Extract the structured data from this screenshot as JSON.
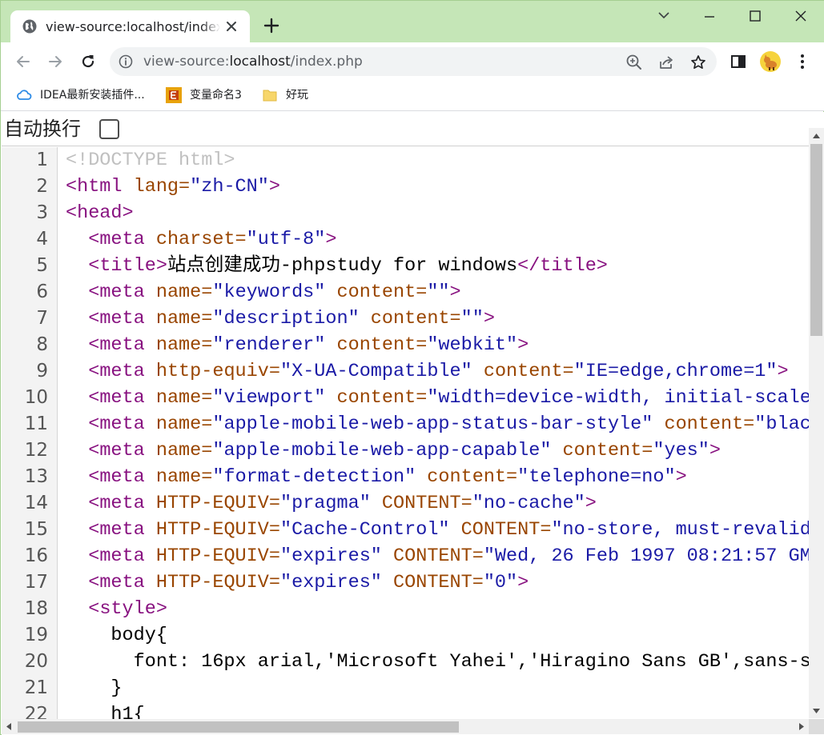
{
  "browser": {
    "tab": {
      "title": "view-source:localhost/index.php"
    },
    "url": {
      "scheme": "view-source:",
      "host": "localhost",
      "path": "/index.php"
    },
    "bookmarks": [
      {
        "label": "IDEA最新安装插件..."
      },
      {
        "label": "变量命名3"
      },
      {
        "label": "好玩"
      }
    ]
  },
  "viewer": {
    "wrap_label": "自动换行",
    "wrap_checked": false
  },
  "source_lines": [
    {
      "n": "1",
      "parts": [
        [
          "doc",
          "<!DOCTYPE html>"
        ]
      ]
    },
    {
      "n": "2",
      "parts": [
        [
          "tag",
          "<html "
        ],
        [
          "attr",
          "lang="
        ],
        [
          "val",
          "\"zh-CN\""
        ],
        [
          "tag",
          ">"
        ]
      ]
    },
    {
      "n": "3",
      "parts": [
        [
          "tag",
          "<head>"
        ]
      ]
    },
    {
      "n": "4",
      "parts": [
        [
          "txt",
          "  "
        ],
        [
          "tag",
          "<meta "
        ],
        [
          "attr",
          "charset="
        ],
        [
          "val",
          "\"utf-8\""
        ],
        [
          "tag",
          ">"
        ]
      ]
    },
    {
      "n": "5",
      "parts": [
        [
          "txt",
          "  "
        ],
        [
          "tag",
          "<title>"
        ],
        [
          "txt",
          "站点创建成功-phpstudy for windows"
        ],
        [
          "tag",
          "</title>"
        ]
      ]
    },
    {
      "n": "6",
      "parts": [
        [
          "txt",
          "  "
        ],
        [
          "tag",
          "<meta "
        ],
        [
          "attr",
          "name="
        ],
        [
          "val",
          "\"keywords\""
        ],
        [
          "attr",
          " content="
        ],
        [
          "val",
          "\"\""
        ],
        [
          "tag",
          ">"
        ]
      ]
    },
    {
      "n": "7",
      "parts": [
        [
          "txt",
          "  "
        ],
        [
          "tag",
          "<meta "
        ],
        [
          "attr",
          "name="
        ],
        [
          "val",
          "\"description\""
        ],
        [
          "attr",
          " content="
        ],
        [
          "val",
          "\"\""
        ],
        [
          "tag",
          ">"
        ]
      ]
    },
    {
      "n": "8",
      "parts": [
        [
          "txt",
          "  "
        ],
        [
          "tag",
          "<meta "
        ],
        [
          "attr",
          "name="
        ],
        [
          "val",
          "\"renderer\""
        ],
        [
          "attr",
          " content="
        ],
        [
          "val",
          "\"webkit\""
        ],
        [
          "tag",
          ">"
        ]
      ]
    },
    {
      "n": "9",
      "parts": [
        [
          "txt",
          "  "
        ],
        [
          "tag",
          "<meta "
        ],
        [
          "attr",
          "http-equiv="
        ],
        [
          "val",
          "\"X-UA-Compatible\""
        ],
        [
          "attr",
          " content="
        ],
        [
          "val",
          "\"IE=edge,chrome=1\""
        ],
        [
          "tag",
          ">"
        ]
      ]
    },
    {
      "n": "10",
      "parts": [
        [
          "txt",
          "  "
        ],
        [
          "tag",
          "<meta "
        ],
        [
          "attr",
          "name="
        ],
        [
          "val",
          "\"viewport\""
        ],
        [
          "attr",
          " content="
        ],
        [
          "val",
          "\"width=device-width, initial-scale"
        ]
      ]
    },
    {
      "n": "11",
      "parts": [
        [
          "txt",
          "  "
        ],
        [
          "tag",
          "<meta "
        ],
        [
          "attr",
          "name="
        ],
        [
          "val",
          "\"apple-mobile-web-app-status-bar-style\""
        ],
        [
          "attr",
          " content="
        ],
        [
          "val",
          "\"blac"
        ]
      ]
    },
    {
      "n": "12",
      "parts": [
        [
          "txt",
          "  "
        ],
        [
          "tag",
          "<meta "
        ],
        [
          "attr",
          "name="
        ],
        [
          "val",
          "\"apple-mobile-web-app-capable\""
        ],
        [
          "attr",
          " content="
        ],
        [
          "val",
          "\"yes\""
        ],
        [
          "tag",
          ">"
        ]
      ]
    },
    {
      "n": "13",
      "parts": [
        [
          "txt",
          "  "
        ],
        [
          "tag",
          "<meta "
        ],
        [
          "attr",
          "name="
        ],
        [
          "val",
          "\"format-detection\""
        ],
        [
          "attr",
          " content="
        ],
        [
          "val",
          "\"telephone=no\""
        ],
        [
          "tag",
          ">"
        ]
      ]
    },
    {
      "n": "14",
      "parts": [
        [
          "txt",
          "  "
        ],
        [
          "tag",
          "<meta "
        ],
        [
          "attr",
          "HTTP-EQUIV="
        ],
        [
          "val",
          "\"pragma\""
        ],
        [
          "attr",
          " CONTENT="
        ],
        [
          "val",
          "\"no-cache\""
        ],
        [
          "tag",
          ">"
        ]
      ]
    },
    {
      "n": "15",
      "parts": [
        [
          "txt",
          "  "
        ],
        [
          "tag",
          "<meta "
        ],
        [
          "attr",
          "HTTP-EQUIV="
        ],
        [
          "val",
          "\"Cache-Control\""
        ],
        [
          "attr",
          " CONTENT="
        ],
        [
          "val",
          "\"no-store, must-revalid"
        ]
      ]
    },
    {
      "n": "16",
      "parts": [
        [
          "txt",
          "  "
        ],
        [
          "tag",
          "<meta "
        ],
        [
          "attr",
          "HTTP-EQUIV="
        ],
        [
          "val",
          "\"expires\""
        ],
        [
          "attr",
          " CONTENT="
        ],
        [
          "val",
          "\"Wed, 26 Feb 1997 08:21:57 GM"
        ]
      ]
    },
    {
      "n": "17",
      "parts": [
        [
          "txt",
          "  "
        ],
        [
          "tag",
          "<meta "
        ],
        [
          "attr",
          "HTTP-EQUIV="
        ],
        [
          "val",
          "\"expires\""
        ],
        [
          "attr",
          " CONTENT="
        ],
        [
          "val",
          "\"0\""
        ],
        [
          "tag",
          ">"
        ]
      ]
    },
    {
      "n": "18",
      "parts": [
        [
          "txt",
          "  "
        ],
        [
          "tag",
          "<style>"
        ]
      ]
    },
    {
      "n": "19",
      "parts": [
        [
          "txt",
          "    body{"
        ]
      ]
    },
    {
      "n": "20",
      "parts": [
        [
          "txt",
          "      font: 16px arial,'Microsoft Yahei','Hiragino Sans GB',sans-s"
        ]
      ]
    },
    {
      "n": "21",
      "parts": [
        [
          "txt",
          "    }"
        ]
      ]
    },
    {
      "n": "22",
      "parts": [
        [
          "txt",
          "    h1{"
        ]
      ]
    }
  ],
  "colors": {
    "tabstrip": "#c5e6b7",
    "tag": "#881280",
    "attr": "#994500",
    "value": "#1a1aa6",
    "doctype": "#c0c0c0"
  },
  "icons": {
    "tab": "globe-icon",
    "tab_close": "close-icon",
    "new_tab": "plus-icon",
    "back": "arrow-left-icon",
    "forward": "arrow-right-icon",
    "reload": "reload-icon",
    "site_info": "info-icon",
    "zoom": "zoom-icon",
    "share": "share-icon",
    "bookmark": "star-icon",
    "side_panel": "side-panel-icon",
    "profile": "avatar",
    "menu": "kebab-menu-icon"
  }
}
